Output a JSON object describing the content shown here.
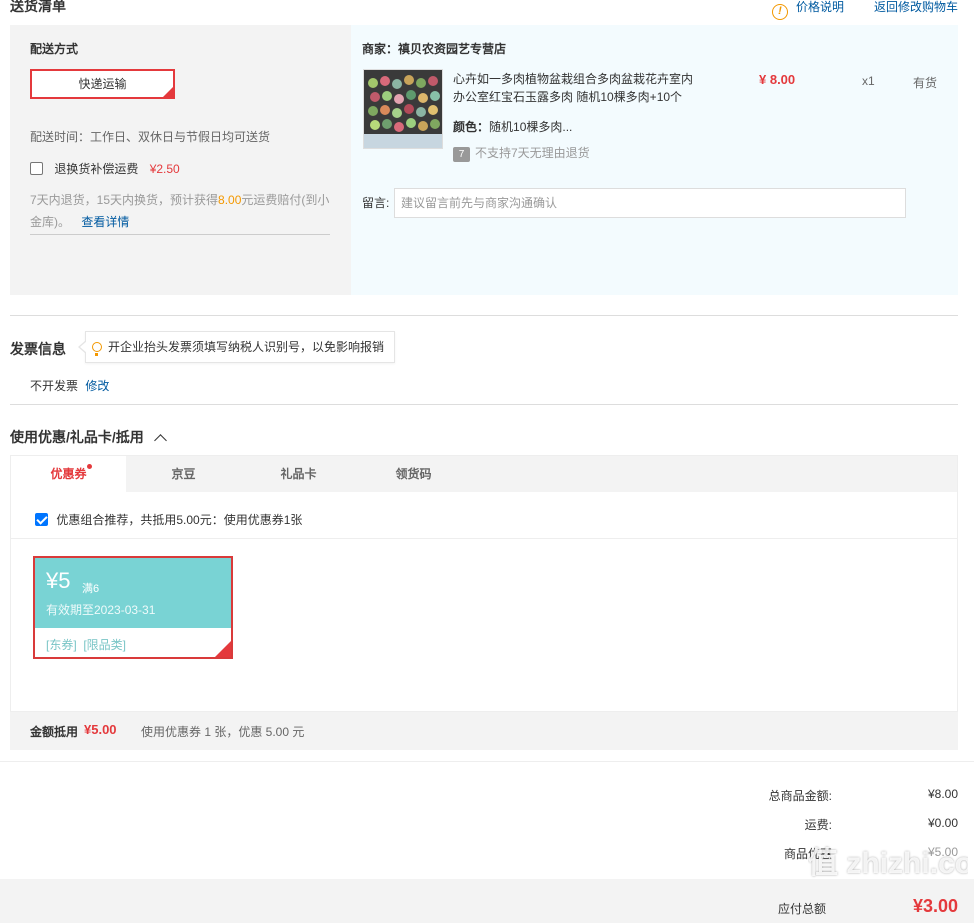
{
  "section_titles": {
    "delivery": "送货清单",
    "invoice": "发票信息",
    "discount": "使用优惠/礼品卡/抵用"
  },
  "top_links": {
    "price_note": "价格说明",
    "back_to_cart": "返回修改购物车"
  },
  "shipping": {
    "method_label": "配送方式",
    "method_value": "快递运输",
    "time_text": "配送时间：工作日、双休日与节假日均可送货",
    "insurance_label": "退换货补偿运费",
    "insurance_price": "¥2.50",
    "insurance_checked": false,
    "insurance_desc_1": "7天内退货，15天内换货，预计获得",
    "insurance_desc_amount": "8.00",
    "insurance_desc_2": "元运费赔付(到小",
    "insurance_desc_3": "金库)。",
    "details_link": "查看详情"
  },
  "merchant": {
    "label": "商家：",
    "name": "禛贝农资园艺专营店",
    "product": {
      "title_line1": "心卉如一多肉植物盆栽组合多肉盆栽花卉室内",
      "title_line2": "办公室红宝石玉露多肉 随机10棵多肉+10个",
      "price": "¥ 8.00",
      "qty": "x1",
      "stock": "有货",
      "color_label": "颜色：",
      "color_value": "随机10棵多肉...",
      "return_badge": "7",
      "return_text": "不支持7天无理由退货"
    },
    "memo_label": "留言:",
    "memo_placeholder": "建议留言前先与商家沟通确认"
  },
  "invoice": {
    "tip": "开企业抬头发票须填写纳税人识别号，以免影响报销",
    "status": "不开发票",
    "modify_link": "修改"
  },
  "discount": {
    "tabs": [
      "优惠券",
      "京豆",
      "礼品卡",
      "领货码"
    ],
    "active_tab": 0,
    "combo_checked": true,
    "combo_text": "优惠组合推荐，共抵用5.00元：使用优惠券1张",
    "coupon": {
      "amount": "¥5",
      "condition": "满6",
      "valid": "有效期至2023-03-31",
      "tags": "[东券]  [限品类]"
    },
    "summary_label": "金额抵用",
    "summary_amount": "¥5.00",
    "summary_desc": "使用优惠券 1 张，优惠 5.00 元"
  },
  "totals": {
    "goods_label": "总商品金额:",
    "goods_value": "¥8.00",
    "freight_label": "运费:",
    "freight_value": "¥0.00",
    "discount_label": "商品优惠",
    "discount_value": "-¥5.00",
    "payable_label": "应付总额",
    "payable_value": "¥3.00"
  },
  "watermark": "值 zhizhi.com",
  "colors": {
    "accent": "#e4393c",
    "link": "#005aa0",
    "coupon": "#79d3d4",
    "orange": "#f39800"
  }
}
